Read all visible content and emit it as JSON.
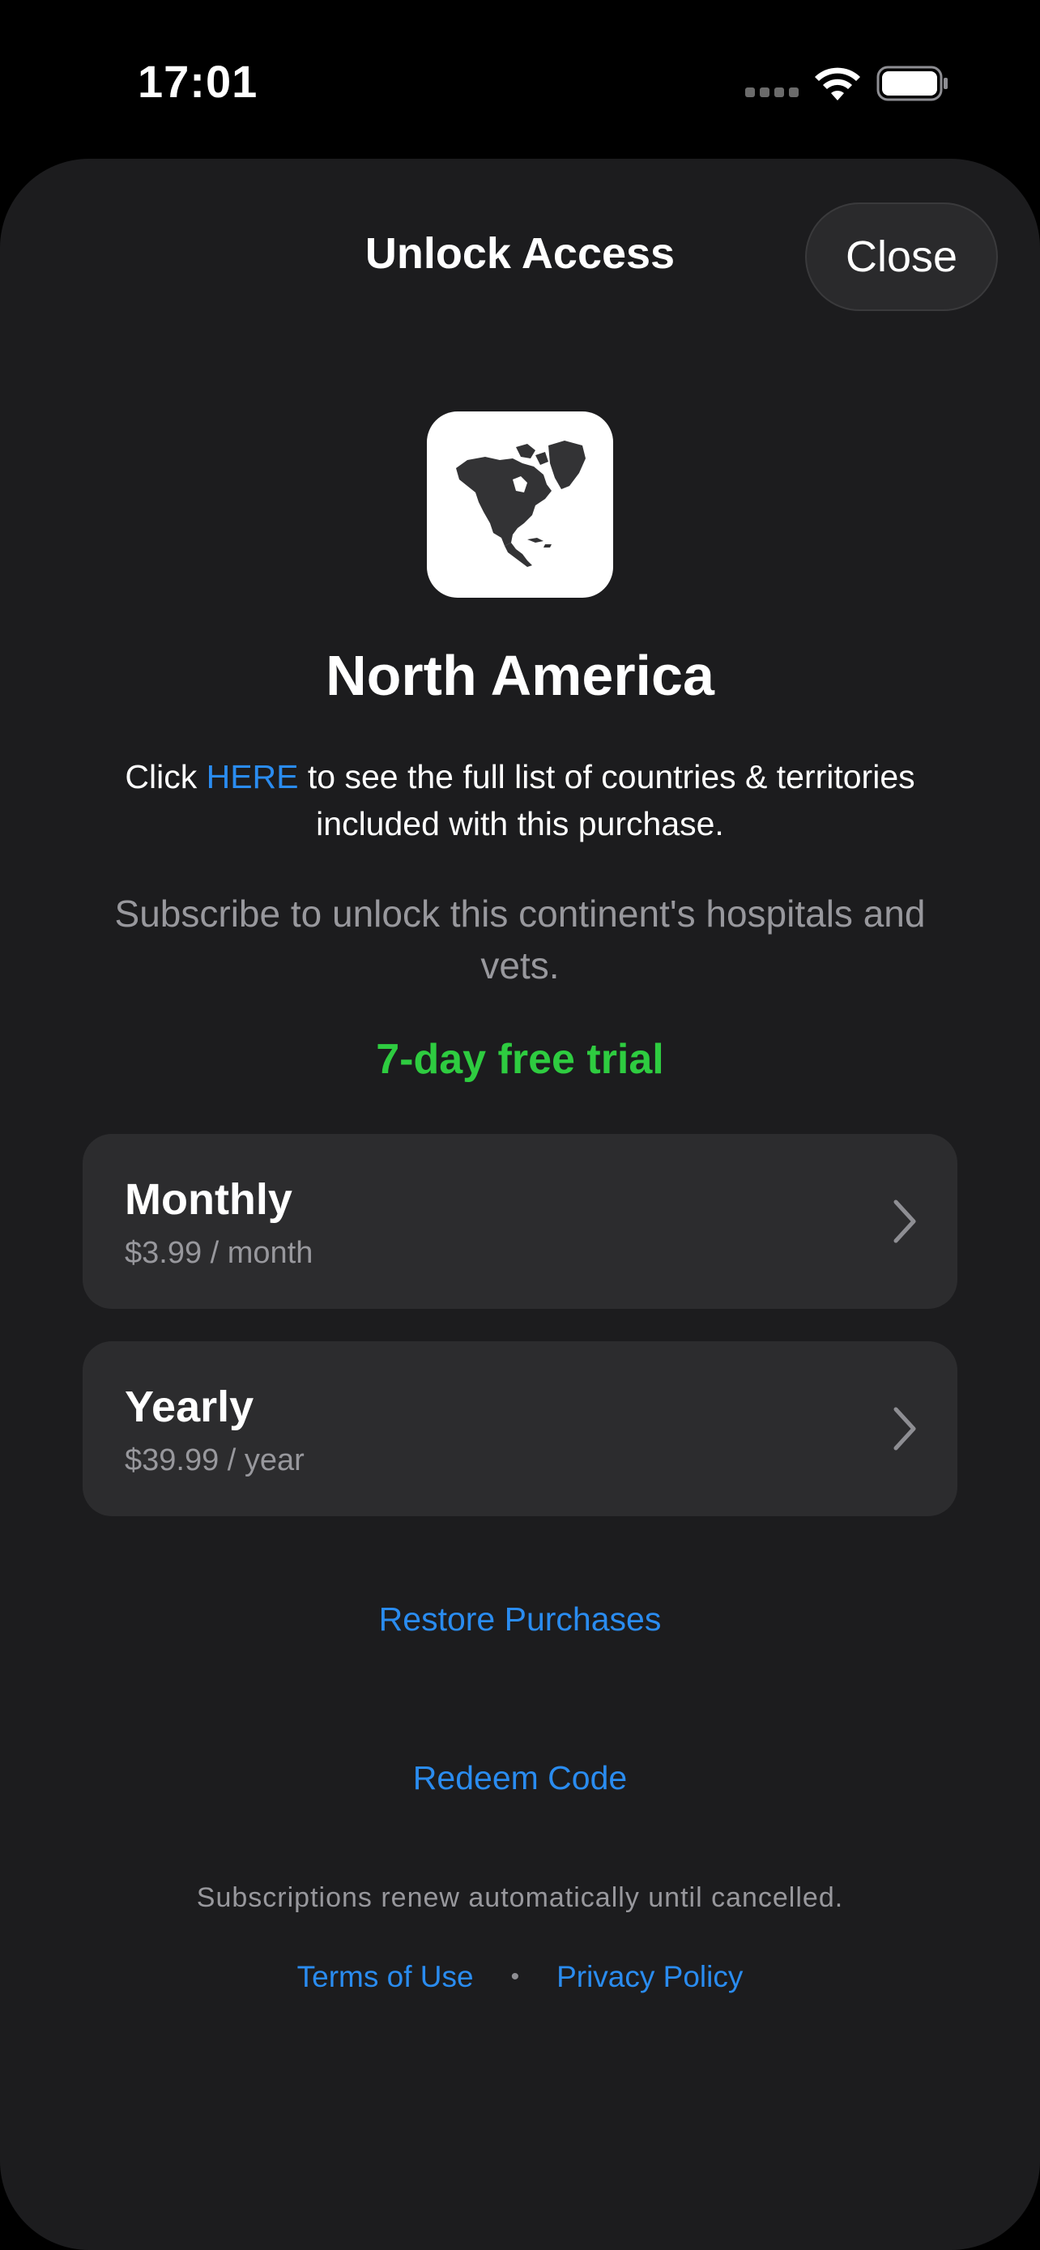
{
  "status_bar": {
    "time": "17:01"
  },
  "sheet": {
    "title": "Unlock Access",
    "close_label": "Close",
    "app_icon": "north-america-map-icon",
    "region_title": "North America",
    "info": {
      "prefix": "Click ",
      "link": "HERE",
      "suffix": " to see the full list of countries & territories included with this purchase."
    },
    "subscribe_text": "Subscribe to unlock this continent's hospitals and vets.",
    "trial_text": "7-day free trial",
    "plans": [
      {
        "name": "Monthly",
        "price": "$3.99 / month"
      },
      {
        "name": "Yearly",
        "price": "$39.99 / year"
      }
    ],
    "restore_label": "Restore Purchases",
    "redeem_label": "Redeem Code",
    "renew_notice": "Subscriptions renew automatically until cancelled.",
    "footer": {
      "terms": "Terms of Use",
      "separator": "•",
      "privacy": "Privacy Policy"
    }
  },
  "colors": {
    "background": "#1c1c1e",
    "card": "#2c2c2e",
    "link": "#2a8cf0",
    "trial": "#2ecc40",
    "secondary_text": "#98989d"
  }
}
